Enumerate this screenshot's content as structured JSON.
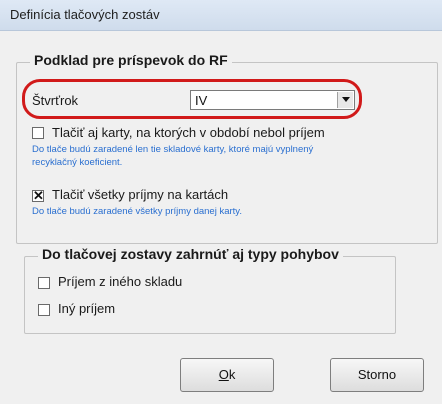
{
  "window": {
    "title": "Definícia tlačových zostáv"
  },
  "group1": {
    "legend": "Podklad pre príspevok do RF",
    "quarter_label": "Štvrťrok",
    "quarter_value": "IV",
    "cb_cards": {
      "label": "Tlačiť aj karty, na ktorých v období nebol príjem",
      "checked": false,
      "note_line1": "Do tlače budú zaradené len tie skladové karty, ktoré majú vyplnený",
      "note_line2": "recyklačný koeficient."
    },
    "cb_all_receipts": {
      "label": "Tlačiť všetky príjmy na kartách",
      "checked": true,
      "note": "Do tlače budú zaradené všetky príjmy danej karty."
    }
  },
  "group2": {
    "legend": "Do tlačovej zostavy zahrnúť aj typy pohybov",
    "items": [
      {
        "label": "Príjem z iného skladu",
        "checked": false
      },
      {
        "label": "Iný príjem",
        "checked": false
      }
    ]
  },
  "buttons": {
    "ok_mnemonic": "O",
    "ok_rest": "k",
    "cancel": "Storno"
  },
  "colors": {
    "highlight": "#d11a1a",
    "note_text": "#2a6fd0"
  }
}
